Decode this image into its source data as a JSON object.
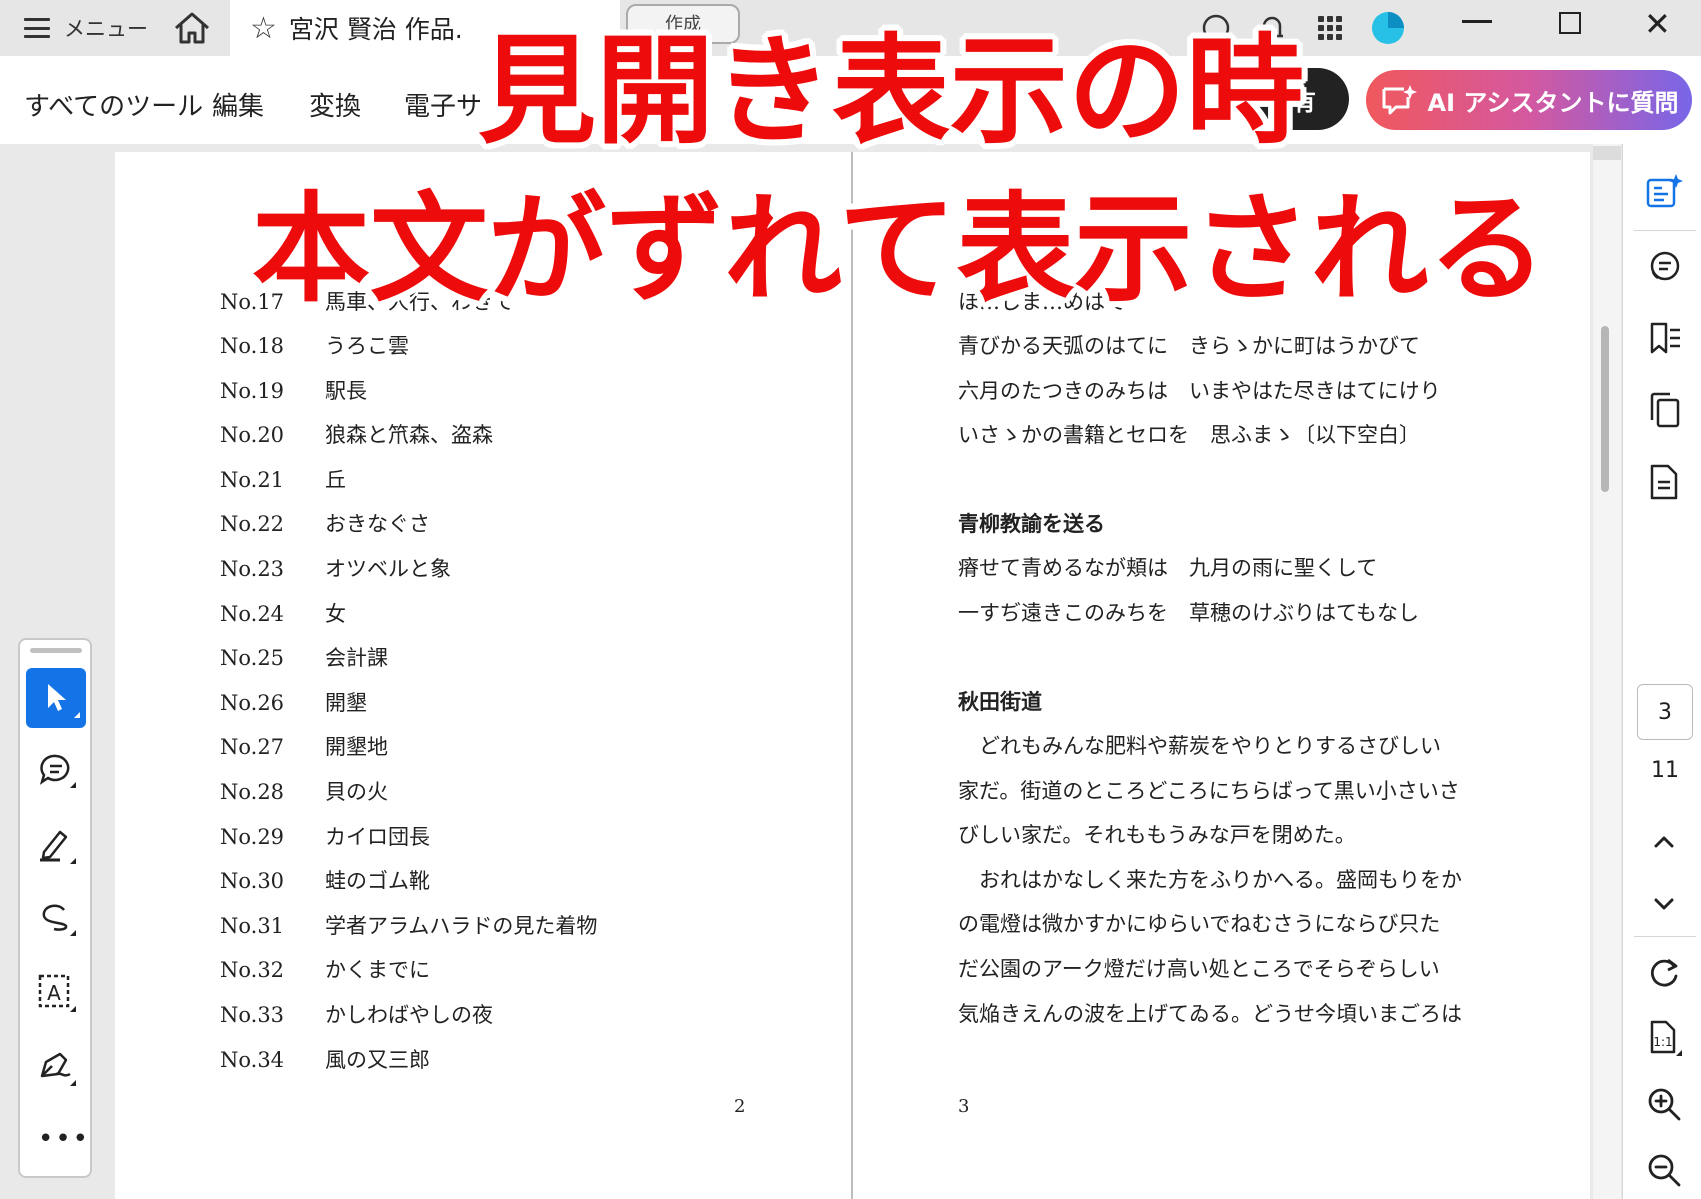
{
  "titlebar": {
    "menu_label": "メニュー",
    "tab_title": "宮沢 賢治 作品.",
    "create_label": "作成"
  },
  "toolbar": {
    "all_tools": "すべてのツール",
    "edit": "編集",
    "convert": "変換",
    "esign": "電子サ",
    "share": "共有",
    "ai_assistant": "AI アシスタントに質問"
  },
  "overlay": {
    "line1": "見開き表示の時",
    "line2": "本文がずれて表示される"
  },
  "left_page": {
    "partial_row": {
      "no": "No.17",
      "title": "馬車、人行、わきて"
    },
    "rows": [
      {
        "no": "No.18",
        "title": "うろこ雲"
      },
      {
        "no": "No.19",
        "title": "駅長"
      },
      {
        "no": "No.20",
        "title": "狼森と笊森、盗森"
      },
      {
        "no": "No.21",
        "title": "丘"
      },
      {
        "no": "No.22",
        "title": "おきなぐさ"
      },
      {
        "no": "No.23",
        "title": "オツベルと象"
      },
      {
        "no": "No.24",
        "title": "女"
      },
      {
        "no": "No.25",
        "title": "会計課"
      },
      {
        "no": "No.26",
        "title": "開墾"
      },
      {
        "no": "No.27",
        "title": "開墾地"
      },
      {
        "no": "No.28",
        "title": "貝の火"
      },
      {
        "no": "No.29",
        "title": "カイロ団長"
      },
      {
        "no": "No.30",
        "title": "蛙のゴム靴"
      },
      {
        "no": "No.31",
        "title": "学者アラムハラドの見た着物"
      },
      {
        "no": "No.32",
        "title": "かくまでに"
      },
      {
        "no": "No.33",
        "title": "かしわばやしの夜"
      },
      {
        "no": "No.34",
        "title": "風の又三郎"
      }
    ],
    "page_number": "2"
  },
  "right_page": {
    "partial_line": "ほ…しま…めはて",
    "lines_a": [
      "青びかる天弧のはてに　きらゝかに町はうかびて",
      "六月のたつきのみちは　いまやはた尽きはてにけり",
      "いさゝかの書籍とセロを　思ふまゝ〔以下空白〕"
    ],
    "section1_title": "青柳教諭を送る",
    "lines_b": [
      "瘠せて青めるなが頬は　九月の雨に聖くして",
      "一すぢ遠きこのみちを　草穂のけぶりはてもなし"
    ],
    "section2_title": "秋田街道",
    "lines_c": [
      "　どれもみんな肥料や薪炭をやりとりするさびしい",
      "家だ。街道のところどころにちらばって黒い小さいさ",
      "びしい家だ。それももうみな戸を閉めた。",
      "　おれはかなしく来た方をふりかへる。盛岡もりをか",
      "の電燈は微かすかにゆらいでねむさうにならび只た",
      "だ公園のアーク燈だけ高い処ところでそらぞらしい",
      "気焔きえんの波を上げてゐる。どうせ今頃いまごろは"
    ],
    "page_number": "3"
  },
  "page_nav": {
    "current": "3",
    "total": "11"
  },
  "colors": {
    "accent": "#1473e6",
    "overlay_red": "#ee0b0b",
    "share_bg": "#222222"
  }
}
